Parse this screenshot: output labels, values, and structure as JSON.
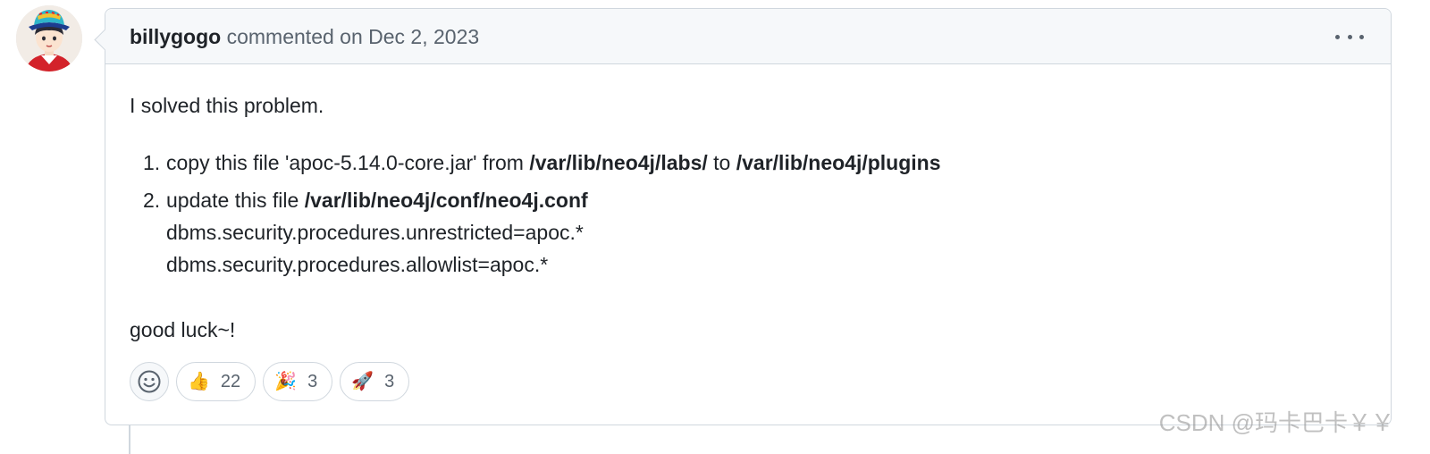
{
  "comment": {
    "author": "billygogo",
    "action": "commented on",
    "date": "Dec 2, 2023",
    "menu_icon": "kebab-horizontal-icon",
    "intro": "I solved this problem.",
    "steps": [
      {
        "number": "1.",
        "text_a": "copy this file 'apoc-5.14.0-core.jar' from ",
        "path_a": "/var/lib/neo4j/labs/",
        "text_b": " to ",
        "path_b": "/var/lib/neo4j/plugins"
      },
      {
        "number": "2.",
        "text_a": "update this file ",
        "path_a": "/var/lib/neo4j/conf/neo4j.conf",
        "config_1": "dbms.security.procedures.unrestricted=apoc.*",
        "config_2": "dbms.security.procedures.allowlist=apoc.*"
      }
    ],
    "outro": "good luck~!",
    "reactions": [
      {
        "icon": "thumbs-up-icon",
        "emoji": "👍",
        "count": "22"
      },
      {
        "icon": "party-popper-icon",
        "emoji": "🎉",
        "count": "3"
      },
      {
        "icon": "rocket-icon",
        "emoji": "🚀",
        "count": "3"
      }
    ]
  },
  "watermark": "CSDN @玛卡巴卡￥￥"
}
